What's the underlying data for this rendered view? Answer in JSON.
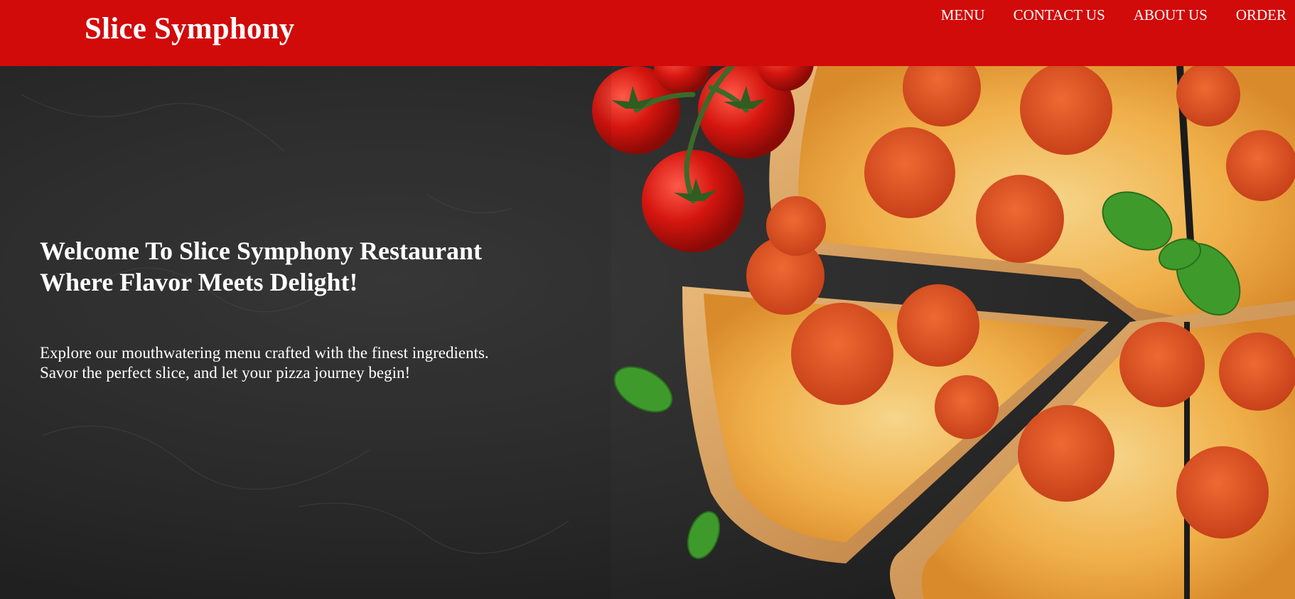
{
  "header": {
    "brand": "Slice Symphony",
    "nav": [
      {
        "label": "MENU"
      },
      {
        "label": "CONTACT US"
      },
      {
        "label": "ABOUT US"
      },
      {
        "label": "ORDER"
      }
    ]
  },
  "hero": {
    "title_line1": "Welcome To Slice Symphony Restaurant",
    "title_line2": "Where Flavor Meets Delight!",
    "desc_line1": "Explore our mouthwatering menu crafted with the finest ingredients.",
    "desc_line2": "Savor the perfect slice, and let your pizza journey begin!",
    "image_subject": "pepperoni pizza with cherry tomatoes and basil on dark stone"
  },
  "colors": {
    "header_bg": "#d10a0a",
    "text": "#ffffff",
    "hero_bg": "#262626"
  }
}
